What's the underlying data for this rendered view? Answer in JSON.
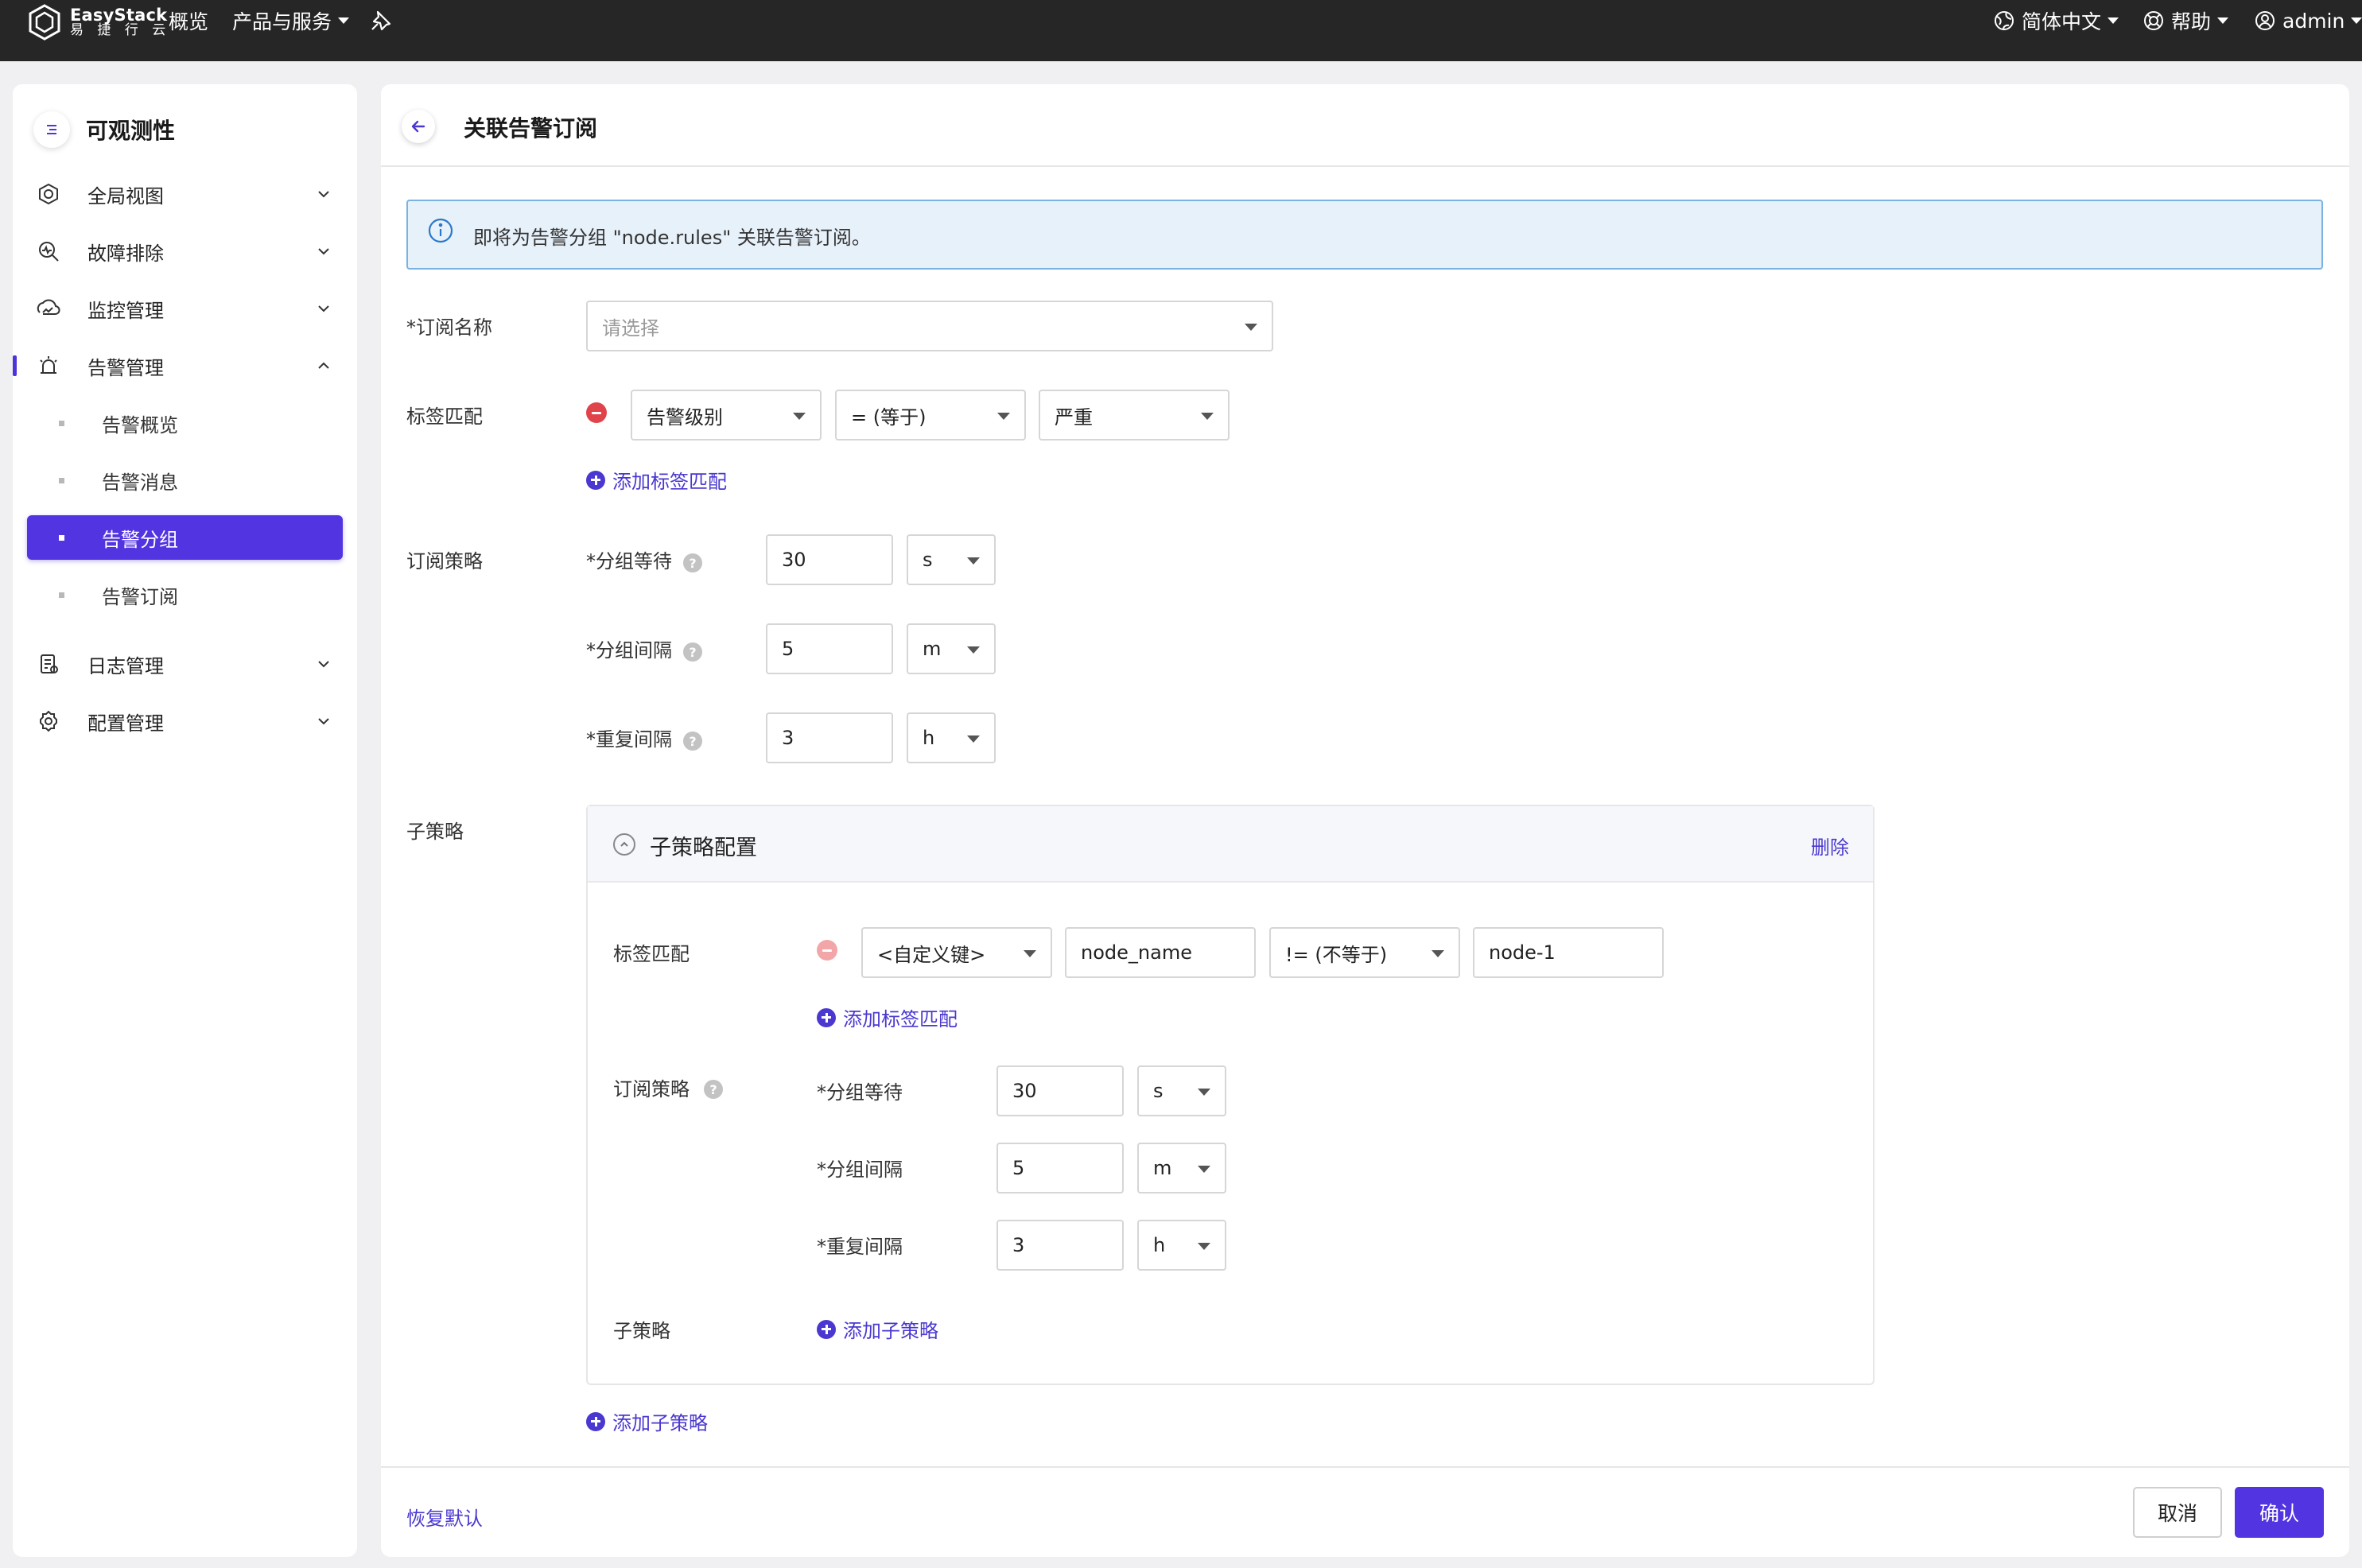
{
  "topbar": {
    "logo_name": "EasyStack",
    "logo_sub": "易 捷 行 云",
    "nav_overview": "概览",
    "nav_products": "产品与服务",
    "lang": "简体中文",
    "help": "帮助",
    "user": "admin"
  },
  "sidebar": {
    "title": "可观测性",
    "items": [
      {
        "label": "全局视图",
        "icon": "global-view-icon"
      },
      {
        "label": "故障排除",
        "icon": "troubleshoot-icon"
      },
      {
        "label": "监控管理",
        "icon": "monitor-icon"
      },
      {
        "label": "告警管理",
        "icon": "alarm-icon"
      },
      {
        "label": "日志管理",
        "icon": "log-icon"
      },
      {
        "label": "配置管理",
        "icon": "gear-icon"
      }
    ],
    "sub_items": [
      {
        "label": "告警概览"
      },
      {
        "label": "告警消息"
      },
      {
        "label": "告警分组",
        "active": true
      },
      {
        "label": "告警订阅"
      }
    ]
  },
  "page": {
    "title": "关联告警订阅",
    "info": "即将为告警分组 \"node.rules\" 关联告警订阅。",
    "subscription_name_label": "*订阅名称",
    "subscription_name_placeholder": "请选择",
    "label_match_label": "标签匹配",
    "label_match": {
      "key": "告警级别",
      "op": "= (等于)",
      "value": "严重"
    },
    "add_label_match": "添加标签匹配",
    "policy_label": "订阅策略",
    "policy": [
      {
        "label": "*分组等待",
        "value": "30",
        "unit": "s"
      },
      {
        "label": "*分组间隔",
        "value": "5",
        "unit": "m"
      },
      {
        "label": "*重复间隔",
        "value": "3",
        "unit": "h"
      }
    ],
    "sub_policy_label": "子策略",
    "sub_policy_card": {
      "title": "子策略配置",
      "delete": "删除",
      "label_match_label": "标签匹配",
      "label_match": {
        "key": "<自定义键>",
        "key_input": "node_name",
        "op": "!= (不等于)",
        "value": "node-1"
      },
      "add_label_match": "添加标签匹配",
      "policy_label": "订阅策略",
      "policy": [
        {
          "label": "*分组等待",
          "value": "30",
          "unit": "s"
        },
        {
          "label": "*分组间隔",
          "value": "5",
          "unit": "m"
        },
        {
          "label": "*重复间隔",
          "value": "3",
          "unit": "h"
        }
      ],
      "sub_policy_label": "子策略",
      "add_sub_policy": "添加子策略"
    },
    "add_sub_policy": "添加子策略"
  },
  "footer": {
    "restore": "恢复默认",
    "cancel": "取消",
    "confirm": "确认"
  },
  "colors": {
    "accent": "#5234e0",
    "topbar": "#262626",
    "danger": "#e0444a",
    "info_bg": "#e7f1fa"
  }
}
